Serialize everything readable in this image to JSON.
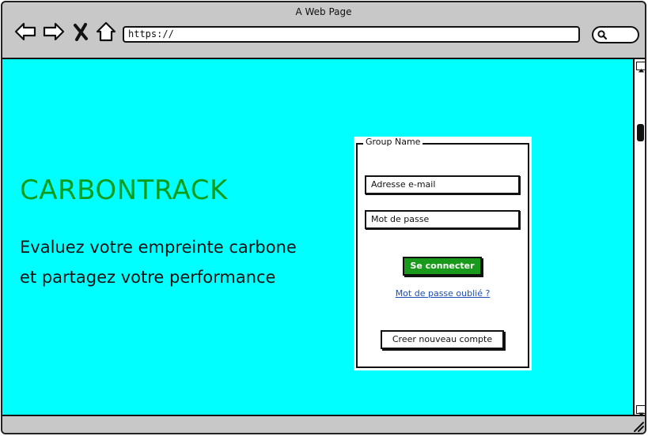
{
  "browser": {
    "title": "A Web Page",
    "url": "https://",
    "icons": {
      "back": "back-arrow-icon",
      "forward": "forward-arrow-icon",
      "stop": "close-icon",
      "home": "home-icon",
      "search": "search-icon"
    }
  },
  "hero": {
    "brand": "CARBONTRACK",
    "tagline_line1": "Evaluez votre empreinte carbone",
    "tagline_line2": "et partagez votre performance"
  },
  "login": {
    "group_name": "Group Name",
    "email_placeholder": "Adresse e-mail",
    "password_placeholder": "Mot de passe",
    "submit_label": "Se connecter",
    "forgot_label": "Mot de passe oublié ?",
    "create_label": "Creer nouveau compte"
  },
  "colors": {
    "background": "#00ffff",
    "brand": "#0a9c1a",
    "submit_button": "#1a9a1a",
    "link": "#1b4db3"
  }
}
